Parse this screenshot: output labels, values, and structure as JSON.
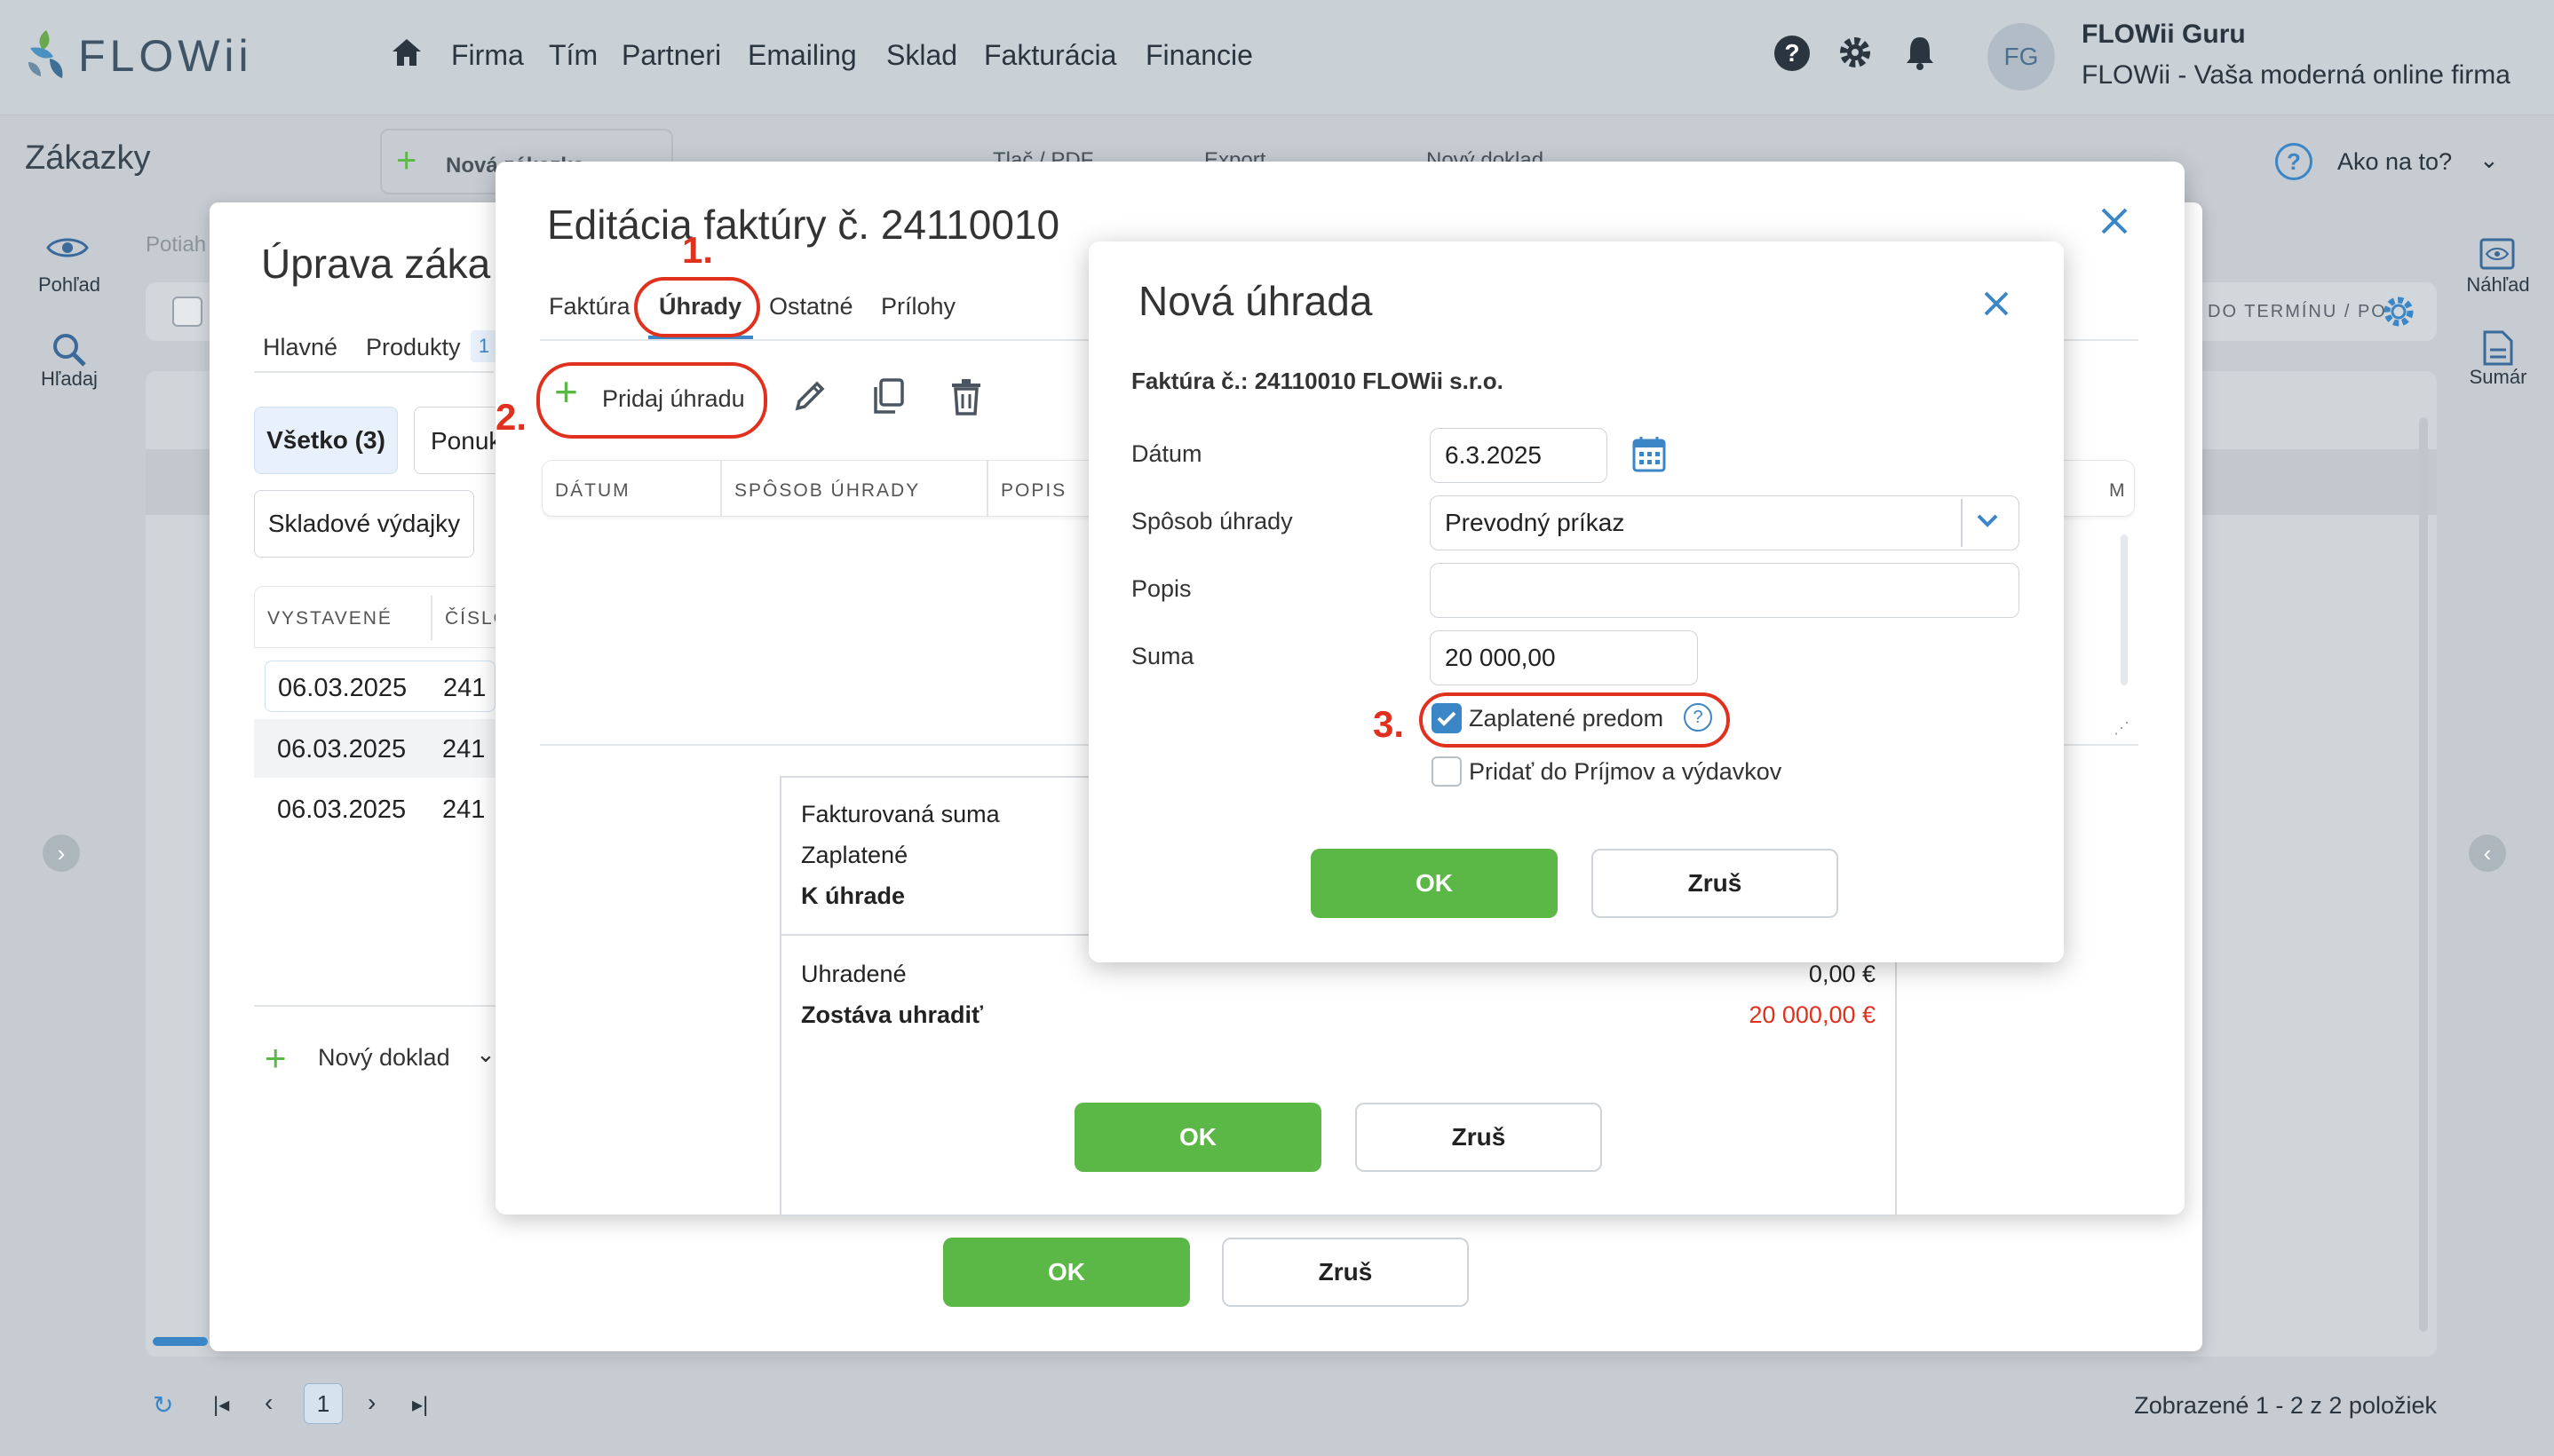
{
  "app": {
    "logo": "FLOWii",
    "nav": [
      "Firma",
      "Tím",
      "Partneri",
      "Emailing",
      "Sklad",
      "Fakturácia",
      "Financie"
    ],
    "user": {
      "initials": "FG",
      "name": "FLOWii Guru",
      "company": "FLOWii - Vaša moderná online firma"
    }
  },
  "subheader": {
    "title": "Zákazky",
    "new_order": "Nová zákazka",
    "print_pdf": "Tlač / PDF",
    "export": "Export",
    "new_doc": "Nový doklad",
    "help": "Ako na to?",
    "due_hint": "DO TERMÍNU / PO"
  },
  "left_panel": {
    "view": "Pohľad",
    "search": "Hľadaj",
    "drag_hint": "Potiah"
  },
  "right_panel": {
    "preview": "Náhľad",
    "summary": "Sumár"
  },
  "order_modal": {
    "title": "Úprava záka",
    "tabs": [
      "Hlavné",
      "Produkty"
    ],
    "products_count": "1",
    "filters": {
      "all": "Všetko (3)",
      "offers": "Ponuk",
      "stock": "Skladové výdajky"
    },
    "columns": [
      "VYSTAVENÉ",
      "ČÍSLO"
    ],
    "rows": [
      {
        "date": "06.03.2025",
        "num": "241"
      },
      {
        "date": "06.03.2025",
        "num": "241"
      },
      {
        "date": "06.03.2025",
        "num": "241"
      }
    ],
    "new_doc": "Nový doklad",
    "ok": "OK",
    "cancel": "Zruš"
  },
  "invoice_modal": {
    "title": "Editácia faktúry č. 24110010",
    "tabs": [
      "Faktúra",
      "Úhrady",
      "Ostatné",
      "Prílohy"
    ],
    "add_payment": "Pridaj úhradu",
    "columns": [
      "DÁTUM",
      "SPÔSOB ÚHRADY",
      "POPIS",
      "M"
    ],
    "summary": {
      "invoiced": "Fakturovaná suma",
      "paid": "Zaplatené",
      "to_pay": "K úhrade",
      "settled": "Uhradené",
      "settled_value": "0,00 €",
      "remaining": "Zostáva uhradiť",
      "remaining_value": "20 000,00 €"
    },
    "ok": "OK",
    "cancel": "Zruš"
  },
  "payment_modal": {
    "title": "Nová úhrada",
    "invoice_label": "Faktúra č.: 24110010 FLOWii s.r.o.",
    "date_label": "Dátum",
    "date_value": "6.3.2025",
    "method_label": "Spôsob úhrady",
    "method_value": "Prevodný príkaz",
    "desc_label": "Popis",
    "desc_value": "",
    "sum_label": "Suma",
    "sum_value": "20 000,00",
    "prepaid_label": "Zaplatené predom",
    "prepaid_checked": true,
    "income_label": "Pridať do Príjmov a výdavkov",
    "income_checked": false,
    "ok": "OK",
    "cancel": "Zruš"
  },
  "annotations": [
    "1.",
    "2.",
    "3."
  ],
  "pager": {
    "page": "1",
    "status": "Zobrazené 1 - 2 z 2 položiek"
  },
  "colors": {
    "ok_green": "#5cb846",
    "accent_blue": "#3b86c6",
    "annotation_red": "#e0301e",
    "negative_red": "#e0301e"
  }
}
